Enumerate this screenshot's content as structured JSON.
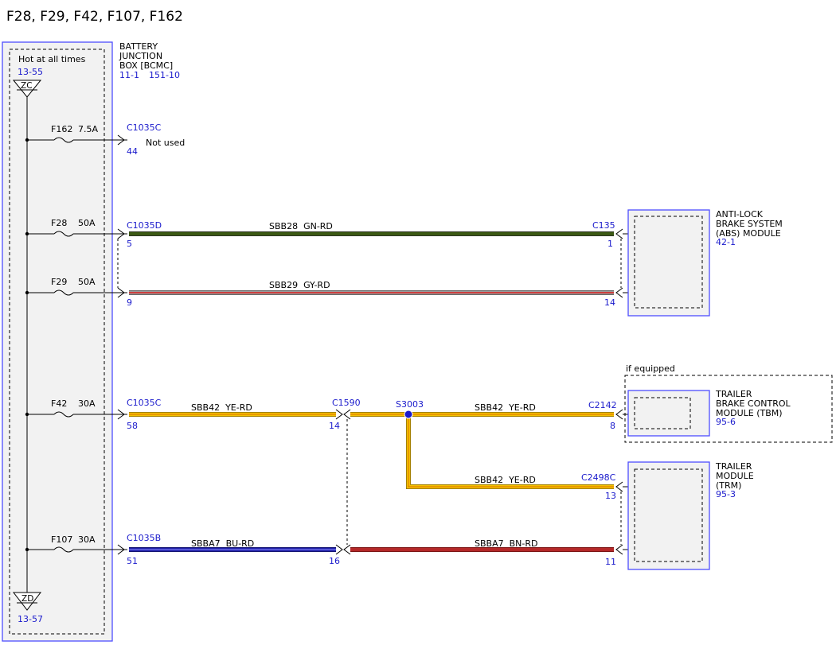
{
  "title": "F28, F29, F42, F107, F162",
  "bjb": {
    "label_lines": [
      "BATTERY",
      "JUNCTION",
      "BOX [BCMC]"
    ],
    "refs": [
      "11-1",
      "151-10"
    ],
    "hot_label": "Hot at all times",
    "top_ref": "13-55",
    "top_node": "ZC",
    "bottom_node": "ZD",
    "bottom_ref": "13-57"
  },
  "fuses": {
    "f162": {
      "name": "F162",
      "rating": "7.5A"
    },
    "f28": {
      "name": "F28",
      "rating": "50A"
    },
    "f29": {
      "name": "F29",
      "rating": "50A"
    },
    "f42": {
      "name": "F42",
      "rating": "30A"
    },
    "f107": {
      "name": "F107",
      "rating": "30A"
    }
  },
  "connectors": {
    "c1035c_top": {
      "id": "C1035C",
      "pin": "44"
    },
    "not_used": "Not used",
    "c1035d": {
      "id": "C1035D",
      "pin5": "5",
      "pin9": "9"
    },
    "c1035c": {
      "id": "C1035C",
      "pin": "58"
    },
    "c1035b": {
      "id": "C1035B",
      "pin": "51"
    },
    "c1590": {
      "id": "C1590",
      "pin14": "14",
      "pin16": "16"
    },
    "s3003": "S3003",
    "c135": {
      "id": "C135",
      "pin1": "1",
      "pin14": "14"
    },
    "c2142": {
      "id": "C2142",
      "pin": "8"
    },
    "c2498c": {
      "id": "C2498C",
      "pin": "13"
    },
    "trm_pin": "11"
  },
  "wires": {
    "sbb28": "SBB28  GN-RD",
    "sbb29": "SBB29  GY-RD",
    "sbb42_a": "SBB42  YE-RD",
    "sbb42_b": "SBB42  YE-RD",
    "sbb42_c": "SBB42  YE-RD",
    "sbba7_a": "SBBA7  BU-RD",
    "sbba7_b": "SBBA7  BN-RD"
  },
  "modules": {
    "abs": {
      "lines": [
        "ANTI-LOCK",
        "BRAKE SYSTEM",
        "(ABS) MODULE"
      ],
      "ref": "42-1"
    },
    "tbm": {
      "lines": [
        "TRAILER",
        "BRAKE CONTROL",
        "MODULE (TBM)"
      ],
      "ref": "95-6",
      "note": "if equipped"
    },
    "trm": {
      "lines": [
        "TRAILER",
        "MODULE",
        "(TRM)"
      ],
      "ref": "95-3"
    }
  },
  "colors": {
    "accent_blue": "#1a1acc",
    "wire_green": "#3c5a14",
    "wire_gray": "#8c8c8c",
    "wire_yellow": "#f2c200",
    "wire_blue": "#1e1ea8",
    "wire_brown_red": "#b42828",
    "wire_red_stripe": "#e02020",
    "box_fill": "#f2f2f2"
  }
}
